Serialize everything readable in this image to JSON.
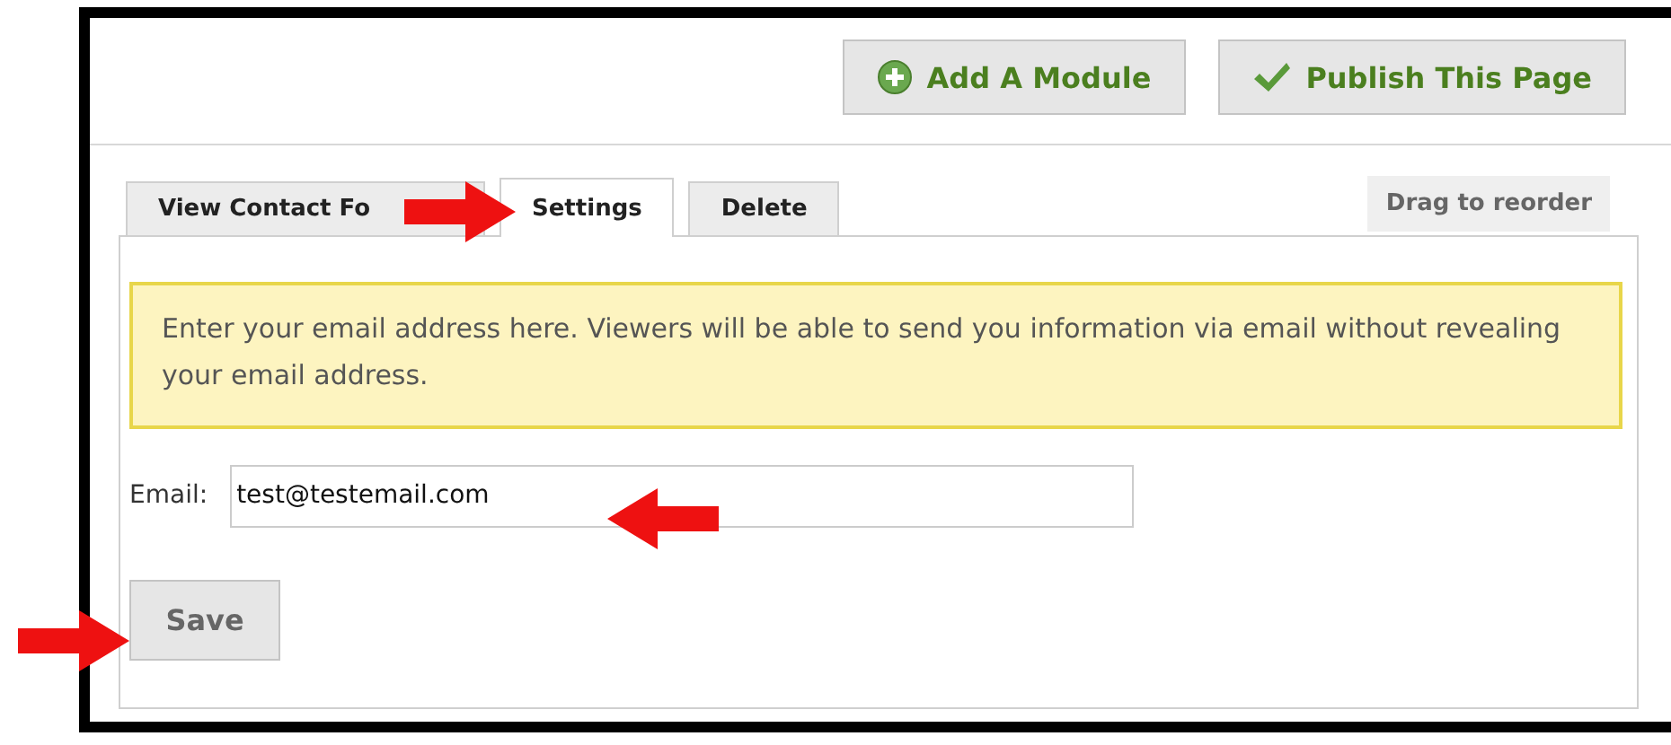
{
  "header_buttons": [
    {
      "label": "Add A Module",
      "kind": "add"
    },
    {
      "label": "Publish This Page",
      "kind": "publish"
    }
  ],
  "tabs": [
    {
      "label": "View Contact Fo",
      "selected": false
    },
    {
      "label": "Settings",
      "selected": true
    },
    {
      "label": "Delete",
      "selected": false
    }
  ],
  "drag_handle": {
    "label": "Drag to reorder"
  },
  "notice": "Enter your email address here. Viewers will be able to send you information via email without revealing your email address.",
  "email_field": {
    "label": "Email:",
    "value": "test@testemail.com"
  },
  "save_button": {
    "label": "Save"
  },
  "annotations": [
    {
      "kind": "right-arrow"
    },
    {
      "kind": "left-arrow"
    },
    {
      "kind": "right-arrow"
    }
  ]
}
